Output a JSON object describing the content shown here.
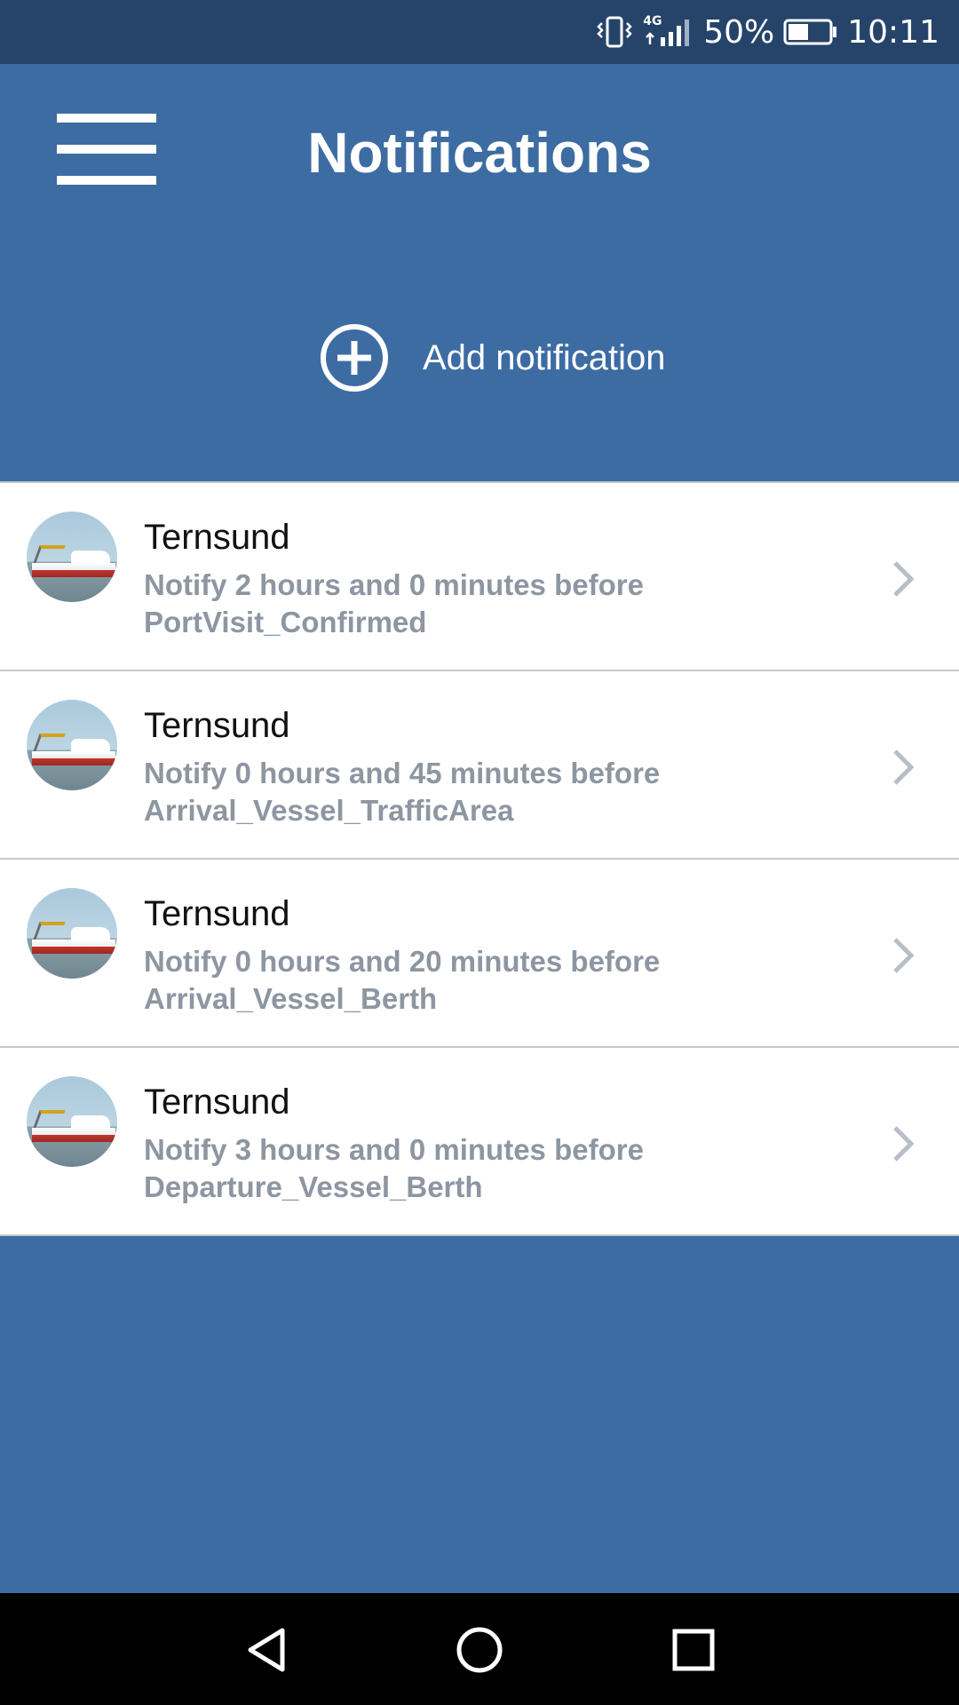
{
  "status_bar": {
    "network": "4G",
    "battery": "50%",
    "battery_level": 0.5,
    "time": "10:11",
    "icons": [
      "vibrate-icon",
      "signal-icon",
      "battery-icon"
    ]
  },
  "header": {
    "menu_icon": "hamburger-menu-icon",
    "title": "Notifications",
    "add_icon": "plus-circle-icon",
    "add_label": "Add notification"
  },
  "notifications": [
    {
      "vessel": "Ternsund",
      "line1": "Notify 2 hours and 0 minutes before",
      "line2": "PortVisit_Confirmed"
    },
    {
      "vessel": "Ternsund",
      "line1": "Notify 0 hours and 45 minutes before",
      "line2": "Arrival_Vessel_TrafficArea"
    },
    {
      "vessel": "Ternsund",
      "line1": "Notify 0 hours and 20 minutes before",
      "line2": "Arrival_Vessel_Berth"
    },
    {
      "vessel": "Ternsund",
      "line1": "Notify 3 hours and 0 minutes before",
      "line2": "Departure_Vessel_Berth"
    }
  ],
  "nav_bar": {
    "icons": [
      "back-icon",
      "home-icon",
      "recents-icon"
    ]
  },
  "colors": {
    "status_bar": "#26446a",
    "primary": "#3d6ca3",
    "muted_text": "#8d96a1"
  }
}
